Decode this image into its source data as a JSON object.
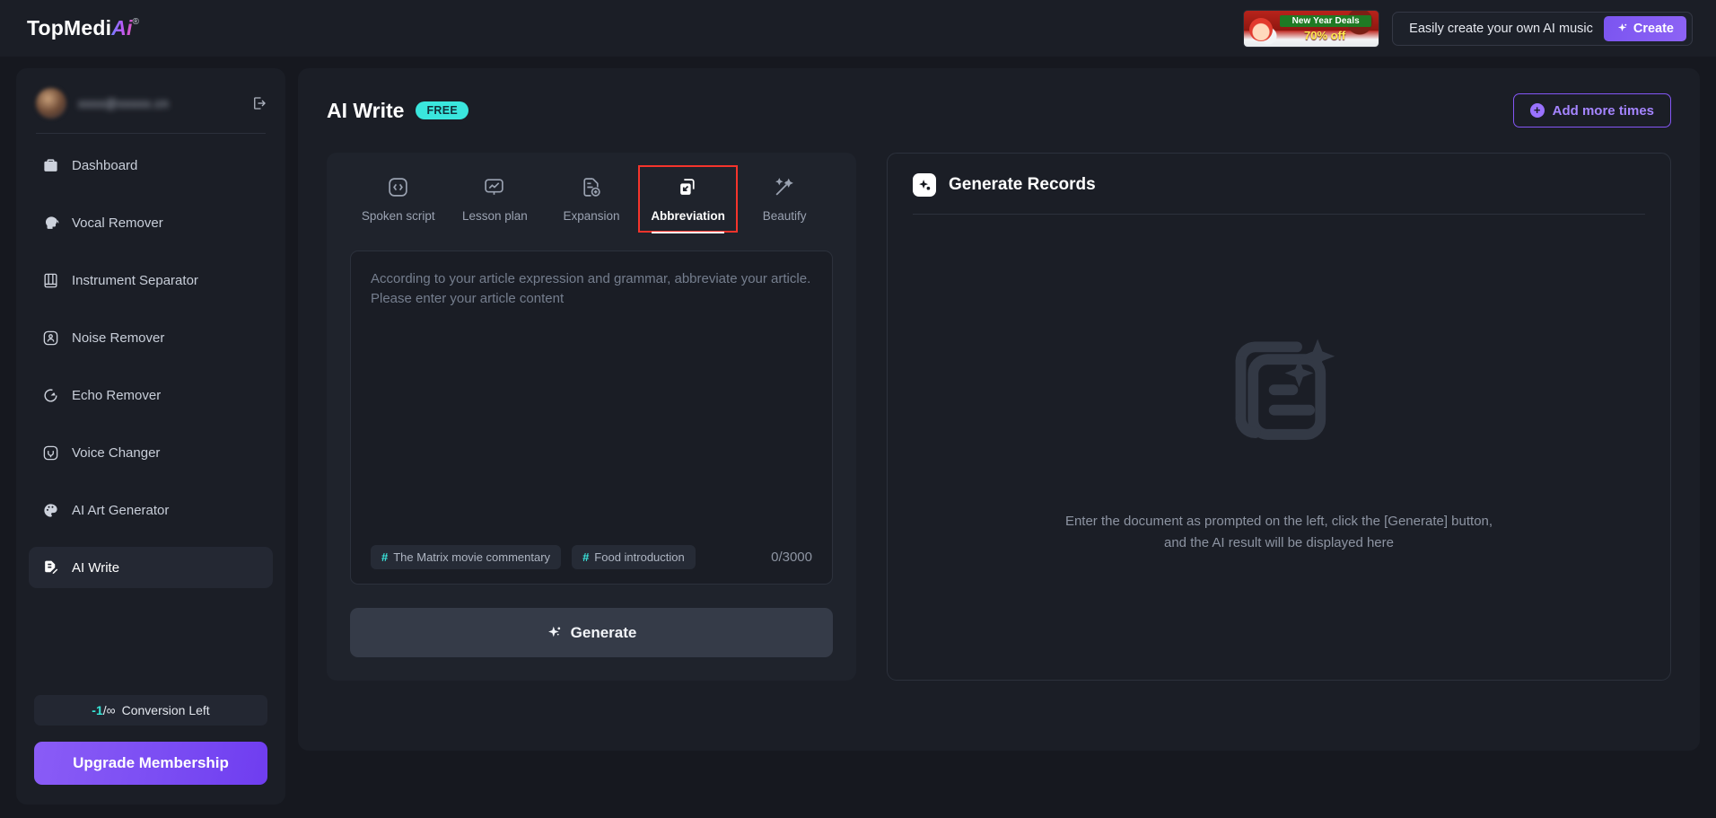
{
  "topbar": {
    "logo_main": "TopMedi",
    "logo_ai": "Ai",
    "logo_reg": "®",
    "promo_line1": "New Year Deals",
    "promo_line2": "70% off",
    "music_cta_text": "Easily create your own AI music",
    "create_label": "Create"
  },
  "sidebar": {
    "profile_email": "xxxx@xxxxx.cn",
    "items": [
      {
        "label": "Dashboard",
        "icon": "briefcase-icon",
        "active": false
      },
      {
        "label": "Vocal Remover",
        "icon": "head-silhouette-icon",
        "active": false
      },
      {
        "label": "Instrument Separator",
        "icon": "piano-keys-icon",
        "active": false
      },
      {
        "label": "Noise Remover",
        "icon": "noise-person-icon",
        "active": false
      },
      {
        "label": "Echo Remover",
        "icon": "echo-circle-icon",
        "active": false
      },
      {
        "label": "Voice Changer",
        "icon": "voice-circle-icon",
        "active": false
      },
      {
        "label": "AI Art Generator",
        "icon": "palette-icon",
        "active": false
      },
      {
        "label": "AI Write",
        "icon": "document-pencil-icon",
        "active": true
      }
    ],
    "conversion_count": "-1",
    "conversion_divider": "/∞",
    "conversion_label": "Conversion Left",
    "upgrade_label": "Upgrade Membership"
  },
  "main": {
    "page_title": "AI Write",
    "free_badge": "FREE",
    "add_more_times": "Add more times",
    "tabs": [
      {
        "label": "Spoken script",
        "icon": "code-brackets-icon",
        "active": false,
        "highlighted": false
      },
      {
        "label": "Lesson plan",
        "icon": "chart-board-icon",
        "active": false,
        "highlighted": false
      },
      {
        "label": "Expansion",
        "icon": "doc-plus-icon",
        "active": false,
        "highlighted": false
      },
      {
        "label": "Abbreviation",
        "icon": "doc-arrow-in-icon",
        "active": true,
        "highlighted": true
      },
      {
        "label": "Beautify",
        "icon": "magic-wand-icon",
        "active": false,
        "highlighted": false
      }
    ],
    "textarea_placeholder": "According to your article expression and grammar, abbreviate your article. Please enter your article content",
    "textarea_value": "",
    "chips": [
      {
        "hash": "#",
        "label": "The Matrix movie commentary"
      },
      {
        "hash": "#",
        "label": "Food introduction"
      }
    ],
    "counter": "0/3000",
    "generate_label": "Generate"
  },
  "records": {
    "title": "Generate Records",
    "icon": "sparkle-card-icon",
    "empty_line1": "Enter the document as prompted on the left, click the [Generate] button,",
    "empty_line2": "and the AI result will be displayed here",
    "illustration": "document-sparkle-illustration"
  },
  "colors": {
    "accent_purple": "#8456f5",
    "accent_cyan": "#3ae6dd",
    "highlight_red": "#f5342c",
    "panel_bg": "#1b1e26",
    "page_bg": "#16181f"
  }
}
